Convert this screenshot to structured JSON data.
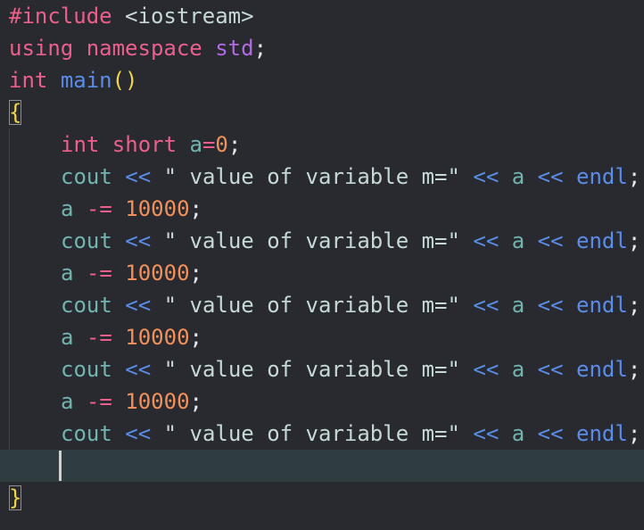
{
  "code": {
    "include_directive": "#include",
    "include_header": " <iostream>",
    "using_kw": "using",
    "namespace_kw": "namespace",
    "std_name": "std",
    "semicolon": ";",
    "int_kw": "int",
    "main_name": "main",
    "parens": "()",
    "open_brace": "{",
    "close_brace": "}",
    "decl_type": "int short",
    "decl_var": "a",
    "decl_eq": "=",
    "decl_val": "0",
    "cout": "cout",
    "shift_op": "<<",
    "string_literal": "\" value of variable m=\"",
    "var_a": "a",
    "endl": "endl",
    "minus_eq": "-=",
    "decrement": "10000"
  }
}
